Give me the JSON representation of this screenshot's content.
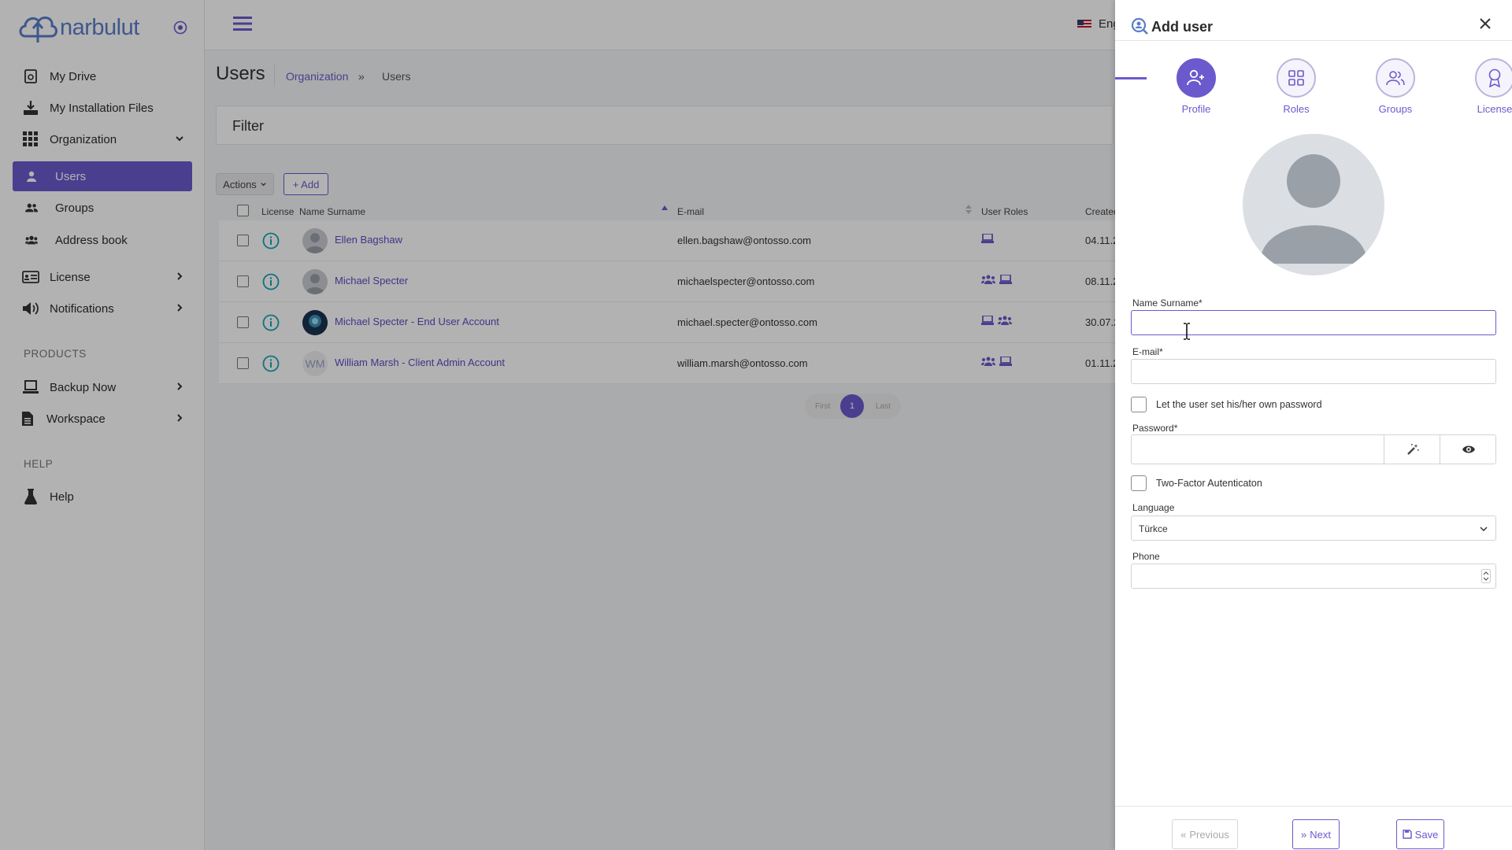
{
  "app": {
    "logo_text": "narbulut",
    "language": "Eng"
  },
  "sidebar": {
    "items": [
      {
        "label": "My Drive"
      },
      {
        "label": "My Installation Files"
      },
      {
        "label": "Organization"
      },
      {
        "label": "Users"
      },
      {
        "label": "Groups"
      },
      {
        "label": "Address book"
      },
      {
        "label": "License"
      },
      {
        "label": "Notifications"
      }
    ],
    "products_label": "PRODUCTS",
    "products": [
      {
        "label": "Backup Now"
      },
      {
        "label": "Workspace"
      }
    ],
    "help_label": "HELP",
    "help": [
      {
        "label": "Help"
      }
    ]
  },
  "page": {
    "title": "Users",
    "breadcrumb": [
      "Organization",
      "»",
      "Users"
    ],
    "filter_label": "Filter",
    "actions_label": "Actions",
    "add_label": "+ Add"
  },
  "table": {
    "columns": [
      "License",
      "Name Surname",
      "E-mail",
      "User Roles",
      "Created"
    ],
    "rows": [
      {
        "name": "Ellen Bagshaw",
        "email": "ellen.bagshaw@ontosso.com",
        "created": "04.11.2"
      },
      {
        "name": "Michael Specter",
        "email": "michaelspecter@ontosso.com",
        "created": "08.11.2"
      },
      {
        "name": "Michael Specter - End User Account",
        "email": "michael.specter@ontosso.com",
        "created": "30.07.2"
      },
      {
        "name": "William Marsh - Client Admin Account",
        "email": "william.marsh@ontosso.com",
        "created": "01.11.2",
        "initials": "WM"
      }
    ]
  },
  "pagination": {
    "first": "First",
    "current": "1",
    "last": "Last"
  },
  "drawer": {
    "title": "Add user",
    "steps": [
      {
        "label": "Profile",
        "active": true
      },
      {
        "label": "Roles"
      },
      {
        "label": "Groups"
      },
      {
        "label": "License"
      }
    ],
    "fields": {
      "name_label": "Name Surname*",
      "name_value": "",
      "email_label": "E-mail*",
      "email_value": "",
      "own_password_label": "Let the user set his/her own password",
      "password_label": "Password*",
      "two_factor_label": "Two-Factor Autenticaton",
      "language_label": "Language",
      "language_value": "Türkce",
      "phone_label": "Phone",
      "phone_value": ""
    },
    "footer": {
      "previous": "Previous",
      "next": "Next",
      "save": "Save"
    }
  },
  "colors": {
    "accent": "#6a5acd",
    "logo": "#5b7dc9"
  }
}
